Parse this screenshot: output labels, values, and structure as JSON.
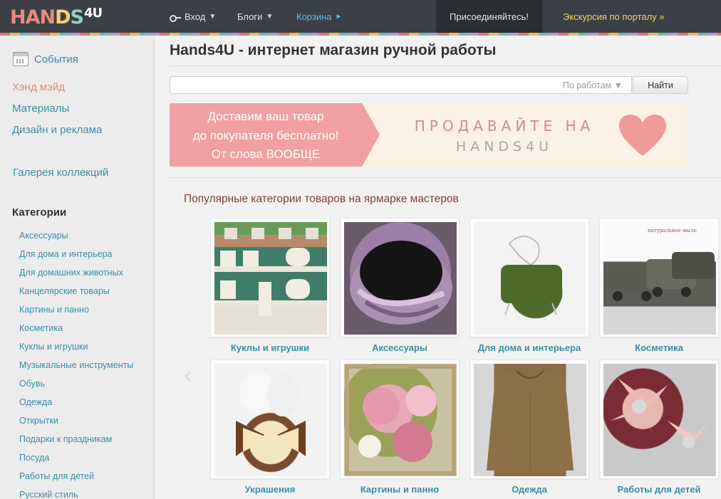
{
  "header": {
    "logo": {
      "part1": "HAN",
      "part2": "D",
      "part3": "S",
      "part4": "4U"
    },
    "nav": {
      "login": "Вход",
      "blogs": "Блоги",
      "cart": "Корзина"
    },
    "join_label": "Присоединяйтесь!",
    "tour_label": "Экскурсия по порталу »"
  },
  "sidebar": {
    "events": "События",
    "handmade": "Хэнд мэйд",
    "materials": "Материалы",
    "design": "Дизайн и реклама",
    "gallery": "Галерея коллекций",
    "categories_title": "Категории",
    "categories": [
      "Аксессуары",
      "Для дома и интерьера",
      "Для домашних животных",
      "Канцелярские товары",
      "Картины и панно",
      "Косметика",
      "Куклы и игрушки",
      "Музыкальные инструменты",
      "Обувь",
      "Одежда",
      "Открытки",
      "Подарки к праздникам",
      "Посуда",
      "Работы для детей",
      "Русский стиль"
    ]
  },
  "main": {
    "title": "Hands4U - интернет магазин ручной работы",
    "search": {
      "placeholder": "",
      "scope": "По работам",
      "button": "Найти"
    },
    "banner": {
      "line1": "Доставим ваш товар",
      "line2": "до покупателя бесплатно!",
      "line3": "От слова ВООБЩЕ",
      "sell": "ПРОДАВАЙТЕ НА",
      "brand": "HANDS4U"
    },
    "popular_title": "Популярные категории товаров на ярмарке мастеров",
    "tiles": [
      "Куклы и игрушки",
      "Аксессуары",
      "Для дома и интерьера",
      "Косметика",
      "Украшения",
      "Картины и панно",
      "Одежда",
      "Работы для детей"
    ],
    "watermark": "натуральное мыло"
  },
  "colors": {
    "topbar": "#3b3f46",
    "link": "#3a8ea8",
    "active": "#e58a6e",
    "accent_yellow": "#f0d56a",
    "cart_blue": "#56c3e8",
    "banner_pink": "#f0a0a0",
    "heart": "#f09a9a"
  }
}
